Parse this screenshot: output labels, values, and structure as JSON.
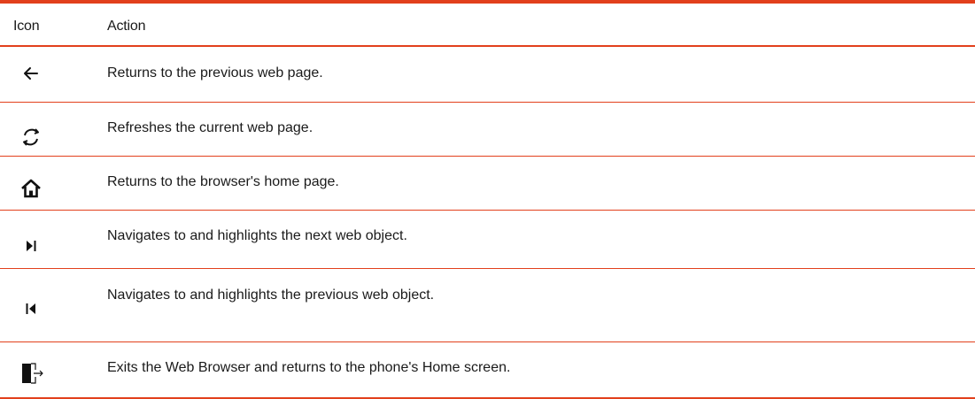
{
  "table": {
    "header": {
      "icon_col": "Icon",
      "action_col": "Action"
    },
    "rows": [
      {
        "icon": "back-arrow-icon",
        "action": "Returns to the previous web page."
      },
      {
        "icon": "refresh-icon",
        "action": "Refreshes the current web page."
      },
      {
        "icon": "home-icon",
        "action": "Returns to the browser's home page."
      },
      {
        "icon": "next-object-icon",
        "action": "Navigates to and highlights the next web object."
      },
      {
        "icon": "previous-object-icon",
        "action": "Navigates to and highlights the previous web object."
      },
      {
        "icon": "exit-icon",
        "action": "Exits the Web Browser and returns to the phone's Home screen."
      }
    ]
  },
  "colors": {
    "rule": "#e2401c",
    "icon": "#111111",
    "text": "#1a1a1a"
  }
}
